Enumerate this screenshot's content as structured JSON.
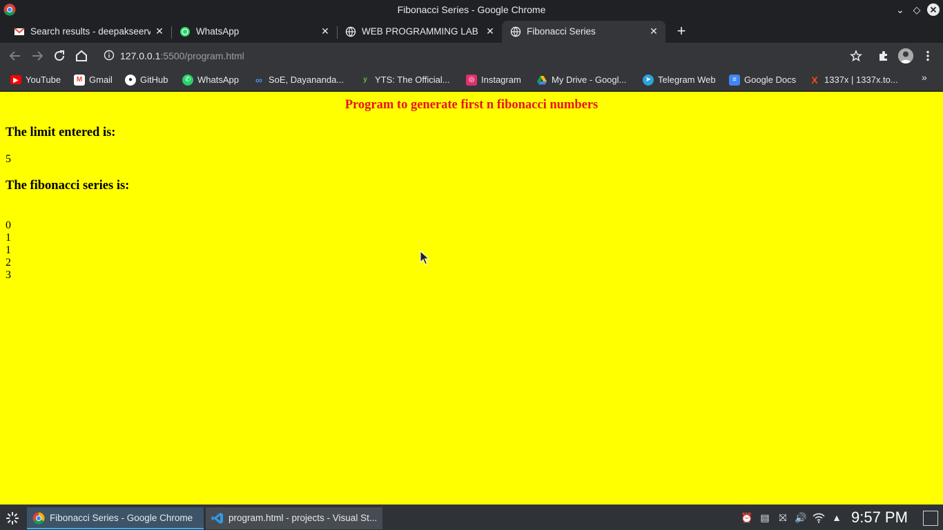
{
  "window": {
    "title": "Fibonacci Series - Google Chrome"
  },
  "tabs": [
    {
      "label": "Search results - deepakseervi",
      "icon": "gmail-icon"
    },
    {
      "label": "WhatsApp",
      "icon": "whatsapp-icon"
    },
    {
      "label": "WEB PROGRAMMING LAB MA",
      "icon": "globe-icon"
    },
    {
      "label": "Fibonacci Series",
      "icon": "globe-icon",
      "active": true
    }
  ],
  "address": {
    "host": "127.0.0.1",
    "rest": ":5500/program.html"
  },
  "bookmarks": [
    {
      "label": "YouTube",
      "icon": "youtube-icon",
      "color": "#ff0000"
    },
    {
      "label": "Gmail",
      "icon": "gmail-icon",
      "color": "#ea4335"
    },
    {
      "label": "GitHub",
      "icon": "github-icon",
      "color": "#ffffff"
    },
    {
      "label": "WhatsApp",
      "icon": "whatsapp-icon",
      "color": "#25d366"
    },
    {
      "label": "SoE, Dayananda...",
      "icon": "infinity-icon",
      "color": "#4a90e2"
    },
    {
      "label": "YTS: The Official...",
      "icon": "yts-icon",
      "color": "#6ac045"
    },
    {
      "label": "Instagram",
      "icon": "instagram-icon",
      "color": "#e1306c"
    },
    {
      "label": "My Drive - Googl...",
      "icon": "drive-icon",
      "color": "#fbbc04"
    },
    {
      "label": "Telegram Web",
      "icon": "telegram-icon",
      "color": "#2aa3df"
    },
    {
      "label": "Google Docs",
      "icon": "docs-icon",
      "color": "#4285f4"
    },
    {
      "label": "1337x | 1337x.to...",
      "icon": "x-icon",
      "color": "#f14e13"
    }
  ],
  "page": {
    "heading": "Program to generate first n fibonacci numbers",
    "limit_label": "The limit entered is:",
    "limit_value": "5",
    "series_label": "The fibonacci series is:",
    "series": [
      "0",
      "1",
      "1",
      "2",
      "3"
    ],
    "background": "#ffff00",
    "heading_color": "#e8141a"
  },
  "taskbar": {
    "tasks": [
      {
        "label": "Fibonacci Series - Google Chrome",
        "icon": "chrome-icon"
      },
      {
        "label": "program.html - projects - Visual St...",
        "icon": "vscode-icon"
      }
    ],
    "clock": "9:57 PM"
  }
}
